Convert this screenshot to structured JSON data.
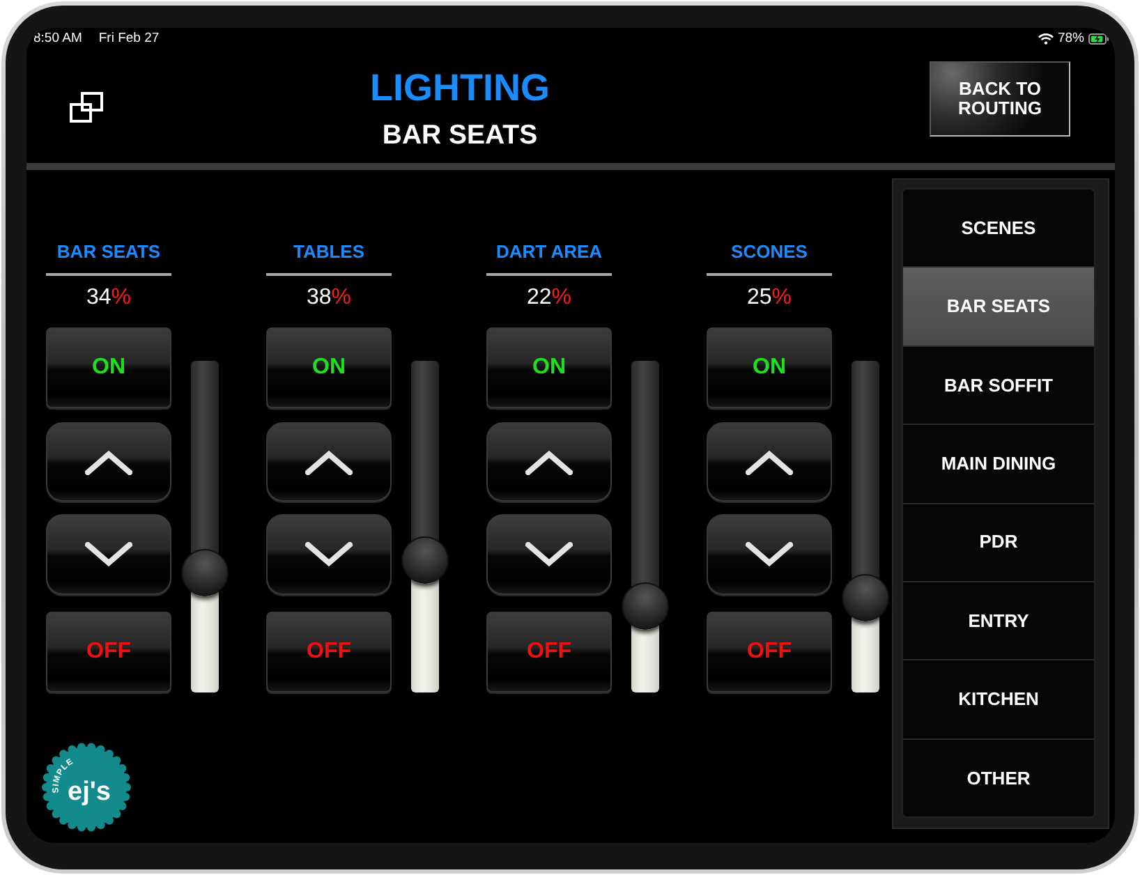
{
  "status_bar": {
    "time": "8:50 AM",
    "date": "Fri Feb 27",
    "battery": "78%"
  },
  "header": {
    "title": "LIGHTING",
    "subtitle": "BAR SEATS",
    "back_button": "BACK TO ROUTING"
  },
  "channels": [
    {
      "name": "BAR SEATS",
      "value": "34",
      "unit": "%",
      "on_label": "ON",
      "off_label": "OFF",
      "level": 0.34
    },
    {
      "name": "TABLES",
      "value": "38",
      "unit": "%",
      "on_label": "ON",
      "off_label": "OFF",
      "level": 0.38
    },
    {
      "name": "DART AREA",
      "value": "22",
      "unit": "%",
      "on_label": "ON",
      "off_label": "OFF",
      "level": 0.22
    },
    {
      "name": "SCONES",
      "value": "25",
      "unit": "%",
      "on_label": "ON",
      "off_label": "OFF",
      "level": 0.25
    }
  ],
  "sidebar": {
    "items": [
      {
        "label": "SCENES",
        "selected": false
      },
      {
        "label": "BAR SEATS",
        "selected": true
      },
      {
        "label": "BAR SOFFIT",
        "selected": false
      },
      {
        "label": "MAIN DINING",
        "selected": false
      },
      {
        "label": "PDR",
        "selected": false
      },
      {
        "label": "ENTRY",
        "selected": false
      },
      {
        "label": "KITCHEN",
        "selected": false
      },
      {
        "label": "OTHER",
        "selected": false
      }
    ]
  },
  "logo": {
    "arc_text": "SIMPLE",
    "wordmark": "ej's"
  }
}
